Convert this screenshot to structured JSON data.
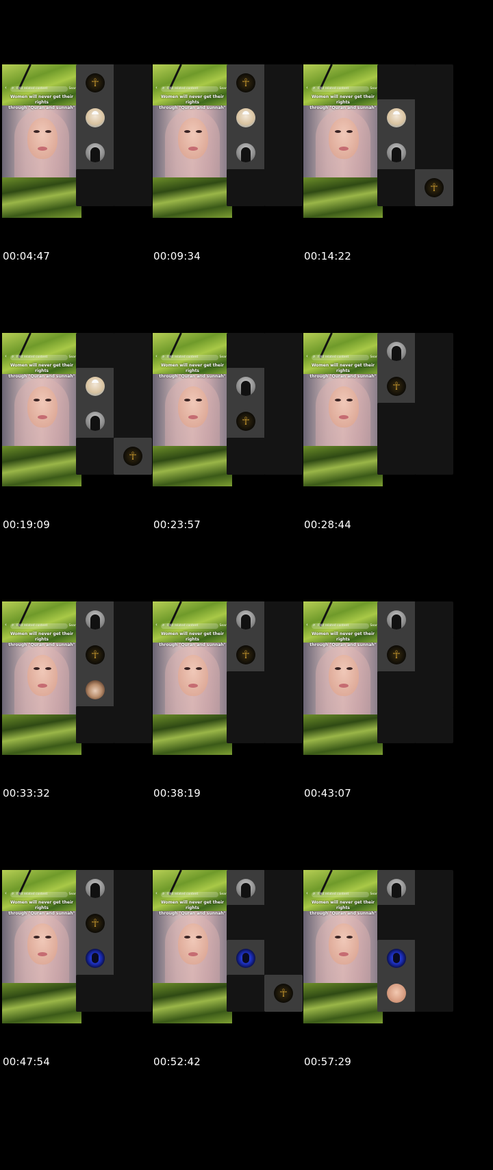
{
  "video": {
    "back_glyph": "‹",
    "search_icon": "search-icon",
    "search_placeholder": "Find related content",
    "search_button": "Search",
    "caption_line1": "Women will never get their rights",
    "caption_line2": "through \"Quran and sunnah\""
  },
  "frames": [
    {
      "timestamp": "00:04:47",
      "tiles": [
        {
          "col": 0,
          "row": 0,
          "avatar": "gold"
        },
        {
          "col": 0,
          "row": 1,
          "avatar": "man"
        },
        {
          "col": 0,
          "row": 2,
          "avatar": "hood"
        }
      ]
    },
    {
      "timestamp": "00:09:34",
      "tiles": [
        {
          "col": 0,
          "row": 0,
          "avatar": "gold"
        },
        {
          "col": 0,
          "row": 1,
          "avatar": "man"
        },
        {
          "col": 0,
          "row": 2,
          "avatar": "hood"
        }
      ]
    },
    {
      "timestamp": "00:14:22",
      "tiles": [
        {
          "col": 0,
          "row": 1,
          "avatar": "man"
        },
        {
          "col": 0,
          "row": 2,
          "avatar": "hood"
        },
        {
          "col": 1,
          "row": 3,
          "avatar": "gold"
        }
      ]
    },
    {
      "timestamp": "00:19:09",
      "tiles": [
        {
          "col": 0,
          "row": 1,
          "avatar": "man"
        },
        {
          "col": 0,
          "row": 2,
          "avatar": "hood"
        },
        {
          "col": 1,
          "row": 3,
          "avatar": "gold"
        }
      ]
    },
    {
      "timestamp": "00:23:57",
      "tiles": [
        {
          "col": 0,
          "row": 1,
          "avatar": "hood"
        },
        {
          "col": 0,
          "row": 2,
          "avatar": "gold"
        }
      ]
    },
    {
      "timestamp": "00:28:44",
      "tiles": [
        {
          "col": 0,
          "row": 0,
          "avatar": "hood"
        },
        {
          "col": 0,
          "row": 1,
          "avatar": "gold"
        }
      ]
    },
    {
      "timestamp": "00:33:32",
      "tiles": [
        {
          "col": 0,
          "row": 0,
          "avatar": "hood"
        },
        {
          "col": 0,
          "row": 1,
          "avatar": "gold"
        },
        {
          "col": 0,
          "row": 2,
          "avatar": "curly"
        }
      ]
    },
    {
      "timestamp": "00:38:19",
      "tiles": [
        {
          "col": 0,
          "row": 0,
          "avatar": "hood"
        },
        {
          "col": 0,
          "row": 1,
          "avatar": "gold"
        }
      ]
    },
    {
      "timestamp": "00:43:07",
      "tiles": [
        {
          "col": 0,
          "row": 0,
          "avatar": "hood"
        },
        {
          "col": 0,
          "row": 1,
          "avatar": "gold"
        }
      ]
    },
    {
      "timestamp": "00:47:54",
      "tiles": [
        {
          "col": 0,
          "row": 0,
          "avatar": "hood"
        },
        {
          "col": 0,
          "row": 1,
          "avatar": "gold"
        },
        {
          "col": 0,
          "row": 2,
          "avatar": "blue"
        }
      ]
    },
    {
      "timestamp": "00:52:42",
      "tiles": [
        {
          "col": 0,
          "row": 0,
          "avatar": "hood"
        },
        {
          "col": 0,
          "row": 2,
          "avatar": "blue"
        },
        {
          "col": 1,
          "row": 3,
          "avatar": "gold"
        }
      ]
    },
    {
      "timestamp": "00:57:29",
      "tiles": [
        {
          "col": 0,
          "row": 0,
          "avatar": "hood"
        },
        {
          "col": 0,
          "row": 2,
          "avatar": "blue"
        },
        {
          "col": 0,
          "row": 3,
          "avatar": "woman"
        }
      ]
    }
  ]
}
